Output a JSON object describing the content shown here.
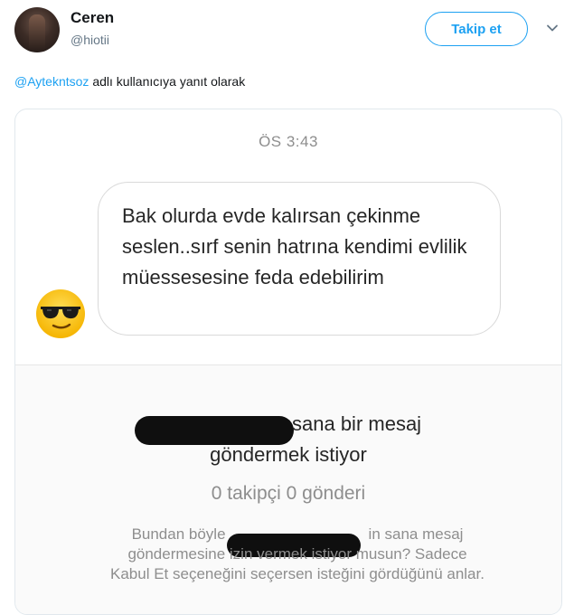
{
  "tweet": {
    "author_name": "Ceren",
    "author_handle": "@hiotii",
    "follow_label": "Takip et",
    "reply_mention": "@Aytekntsoz",
    "reply_text": " adlı kullanıcıya yanıt olarak"
  },
  "screenshot": {
    "time": "ÖS 3:43",
    "message": "Bak olurda evde kalırsan çekinme seslen..sırf senin hatrına kendimi evlilik müessesesine feda edebilirim",
    "emoji": "sunglasses-emoji",
    "request_line1": "sana bir mesaj",
    "request_line2": "göndermek istiyor",
    "stats": "0 takipçi 0 gönderi",
    "description_line1_start": "Bundan böyle",
    "description_line1_end": "in sana mesaj",
    "description_line2": "göndermesine izin vermek istiyor musun? Sadece",
    "description_line3": "Kabul Et seçeneğini seçersen isteğini gördüğünü anlar."
  },
  "colors": {
    "accent": "#1da1f2",
    "muted": "#8e8e8e",
    "redaction": "#0f0f0f"
  }
}
